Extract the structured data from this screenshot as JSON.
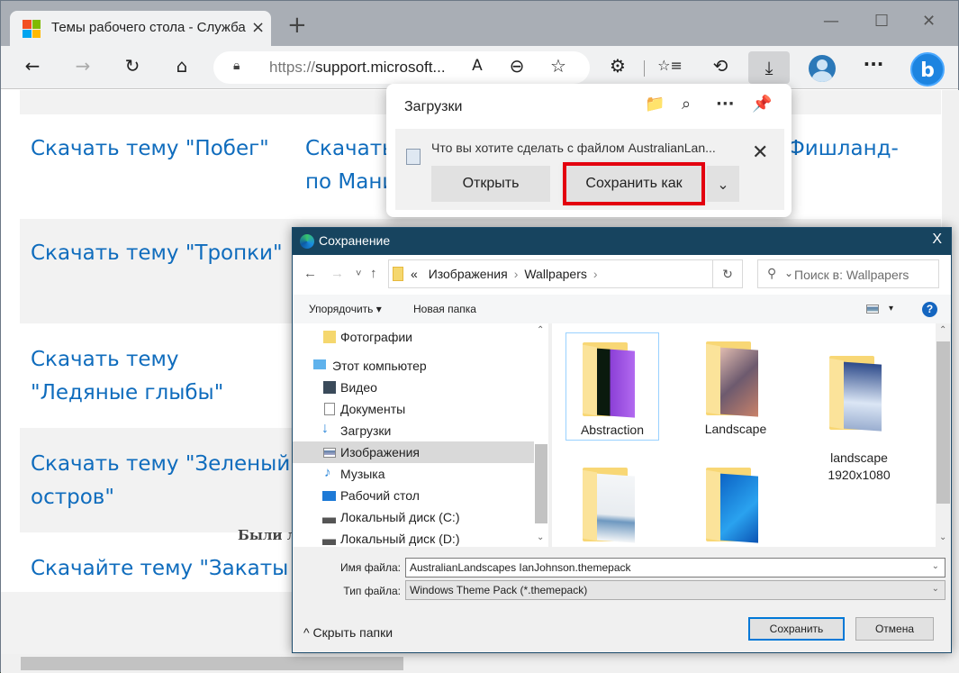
{
  "browser": {
    "tab_title": "Темы рабочего стола - Служба",
    "tab_close": "×",
    "new_tab": "+",
    "window_controls": {
      "minimize": "—",
      "maximize": "☐",
      "close": "✕"
    },
    "toolbar": {
      "back": "←",
      "forward": "→",
      "refresh": "↻",
      "home": "⌂",
      "url_protocol": "https://",
      "url_rest": "support.microsoft...",
      "read_aloud": "A",
      "zoom_out": "⊖",
      "add_favorite": "☆",
      "extensions": "⚙",
      "favorites": "☆≡",
      "history": "⟲",
      "downloads": "⤓",
      "more": "···",
      "bing": "b"
    }
  },
  "page": {
    "links": [
      {
        "text": "Скачать тему \"Побег\""
      },
      {
        "text": "Скачать\nпо Мани"
      },
      {
        "text": "Фишланд-"
      },
      {
        "text": "Скачать тему \"Тропки\""
      },
      {
        "text": "Скачать тему \"Ледяные глыбы\""
      },
      {
        "text": "Скачать тему \"Зеленый остров\""
      },
      {
        "text": "Скачайте тему \"Закаты"
      }
    ],
    "feedback_text": "Были л"
  },
  "downloads_panel": {
    "title": "Загрузки",
    "icons": {
      "open_folder": "📁",
      "search": "⌕",
      "more": "···",
      "pin": "📌"
    },
    "message": "Что вы хотите сделать с файлом AustralianLan...",
    "close": "✕",
    "open_label": "Открыть",
    "save_as_label": "Сохранить как",
    "more_options": "⌄"
  },
  "save_dialog": {
    "title": "Сохранение",
    "close": "X",
    "nav": {
      "back": "←",
      "forward": "→",
      "recent": "˅",
      "up": "↑"
    },
    "breadcrumb": {
      "prefix": "«",
      "items": [
        "Изображения",
        "Wallpapers"
      ]
    },
    "refresh": "↻",
    "search_placeholder": "Поиск в: Wallpapers",
    "commands": {
      "organize": "Упорядочить ▾",
      "new_folder": "Новая папка",
      "view_dd": "▾",
      "help": "?"
    },
    "tree": [
      {
        "label": "Фотографии",
        "icon": "folder-icon"
      },
      {
        "label": "Этот компьютер",
        "icon": "computer-icon"
      },
      {
        "label": "Видео",
        "icon": "video-icon"
      },
      {
        "label": "Документы",
        "icon": "documents-icon"
      },
      {
        "label": "Загрузки",
        "icon": "downloads-icon"
      },
      {
        "label": "Изображения",
        "icon": "pictures-icon",
        "selected": true
      },
      {
        "label": "Музыка",
        "icon": "music-icon"
      },
      {
        "label": "Рабочий стол",
        "icon": "desktop-icon"
      },
      {
        "label": "Локальный диск (C:)",
        "icon": "drive-c-icon"
      },
      {
        "label": "Локальный диск (D:)",
        "icon": "drive-d-icon"
      }
    ],
    "files": [
      {
        "label": "Abstraction",
        "selected": true
      },
      {
        "label": "Landscape"
      },
      {
        "label": "landscape\n1920x1080"
      },
      {
        "label": ""
      },
      {
        "label": ""
      }
    ],
    "filename_label": "Имя файла:",
    "filename_value": "AustralianLandscapes IanJohnson.themepack",
    "filetype_label": "Тип файла:",
    "filetype_value": "Windows Theme Pack (*.themepack)",
    "hide_folders": "^ Скрыть папки",
    "save_button": "Сохранить",
    "cancel_button": "Отмена"
  }
}
